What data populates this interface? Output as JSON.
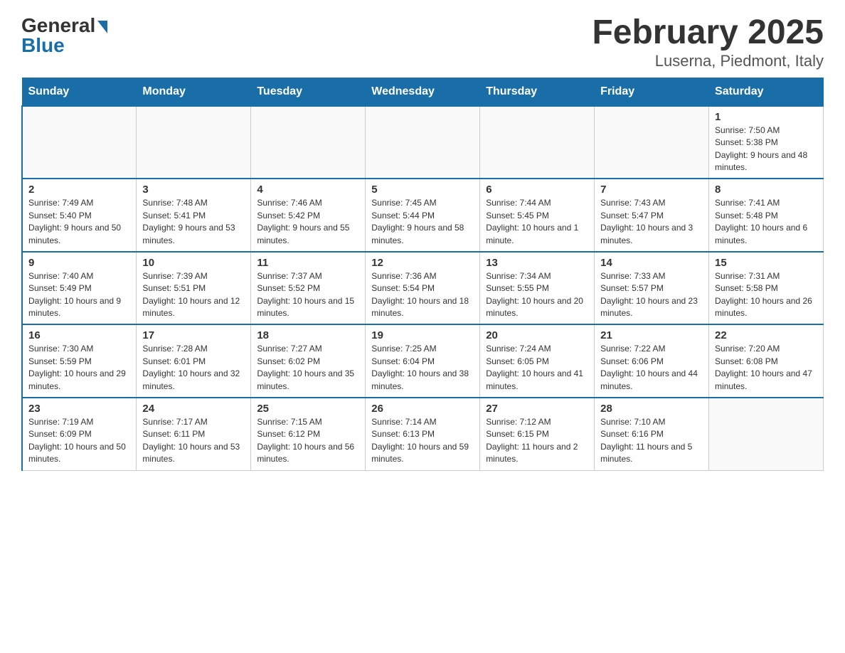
{
  "header": {
    "logo_general": "General",
    "logo_blue": "Blue",
    "title": "February 2025",
    "subtitle": "Luserna, Piedmont, Italy"
  },
  "days_of_week": [
    "Sunday",
    "Monday",
    "Tuesday",
    "Wednesday",
    "Thursday",
    "Friday",
    "Saturday"
  ],
  "weeks": [
    [
      {
        "day": "",
        "info": ""
      },
      {
        "day": "",
        "info": ""
      },
      {
        "day": "",
        "info": ""
      },
      {
        "day": "",
        "info": ""
      },
      {
        "day": "",
        "info": ""
      },
      {
        "day": "",
        "info": ""
      },
      {
        "day": "1",
        "info": "Sunrise: 7:50 AM\nSunset: 5:38 PM\nDaylight: 9 hours and 48 minutes."
      }
    ],
    [
      {
        "day": "2",
        "info": "Sunrise: 7:49 AM\nSunset: 5:40 PM\nDaylight: 9 hours and 50 minutes."
      },
      {
        "day": "3",
        "info": "Sunrise: 7:48 AM\nSunset: 5:41 PM\nDaylight: 9 hours and 53 minutes."
      },
      {
        "day": "4",
        "info": "Sunrise: 7:46 AM\nSunset: 5:42 PM\nDaylight: 9 hours and 55 minutes."
      },
      {
        "day": "5",
        "info": "Sunrise: 7:45 AM\nSunset: 5:44 PM\nDaylight: 9 hours and 58 minutes."
      },
      {
        "day": "6",
        "info": "Sunrise: 7:44 AM\nSunset: 5:45 PM\nDaylight: 10 hours and 1 minute."
      },
      {
        "day": "7",
        "info": "Sunrise: 7:43 AM\nSunset: 5:47 PM\nDaylight: 10 hours and 3 minutes."
      },
      {
        "day": "8",
        "info": "Sunrise: 7:41 AM\nSunset: 5:48 PM\nDaylight: 10 hours and 6 minutes."
      }
    ],
    [
      {
        "day": "9",
        "info": "Sunrise: 7:40 AM\nSunset: 5:49 PM\nDaylight: 10 hours and 9 minutes."
      },
      {
        "day": "10",
        "info": "Sunrise: 7:39 AM\nSunset: 5:51 PM\nDaylight: 10 hours and 12 minutes."
      },
      {
        "day": "11",
        "info": "Sunrise: 7:37 AM\nSunset: 5:52 PM\nDaylight: 10 hours and 15 minutes."
      },
      {
        "day": "12",
        "info": "Sunrise: 7:36 AM\nSunset: 5:54 PM\nDaylight: 10 hours and 18 minutes."
      },
      {
        "day": "13",
        "info": "Sunrise: 7:34 AM\nSunset: 5:55 PM\nDaylight: 10 hours and 20 minutes."
      },
      {
        "day": "14",
        "info": "Sunrise: 7:33 AM\nSunset: 5:57 PM\nDaylight: 10 hours and 23 minutes."
      },
      {
        "day": "15",
        "info": "Sunrise: 7:31 AM\nSunset: 5:58 PM\nDaylight: 10 hours and 26 minutes."
      }
    ],
    [
      {
        "day": "16",
        "info": "Sunrise: 7:30 AM\nSunset: 5:59 PM\nDaylight: 10 hours and 29 minutes."
      },
      {
        "day": "17",
        "info": "Sunrise: 7:28 AM\nSunset: 6:01 PM\nDaylight: 10 hours and 32 minutes."
      },
      {
        "day": "18",
        "info": "Sunrise: 7:27 AM\nSunset: 6:02 PM\nDaylight: 10 hours and 35 minutes."
      },
      {
        "day": "19",
        "info": "Sunrise: 7:25 AM\nSunset: 6:04 PM\nDaylight: 10 hours and 38 minutes."
      },
      {
        "day": "20",
        "info": "Sunrise: 7:24 AM\nSunset: 6:05 PM\nDaylight: 10 hours and 41 minutes."
      },
      {
        "day": "21",
        "info": "Sunrise: 7:22 AM\nSunset: 6:06 PM\nDaylight: 10 hours and 44 minutes."
      },
      {
        "day": "22",
        "info": "Sunrise: 7:20 AM\nSunset: 6:08 PM\nDaylight: 10 hours and 47 minutes."
      }
    ],
    [
      {
        "day": "23",
        "info": "Sunrise: 7:19 AM\nSunset: 6:09 PM\nDaylight: 10 hours and 50 minutes."
      },
      {
        "day": "24",
        "info": "Sunrise: 7:17 AM\nSunset: 6:11 PM\nDaylight: 10 hours and 53 minutes."
      },
      {
        "day": "25",
        "info": "Sunrise: 7:15 AM\nSunset: 6:12 PM\nDaylight: 10 hours and 56 minutes."
      },
      {
        "day": "26",
        "info": "Sunrise: 7:14 AM\nSunset: 6:13 PM\nDaylight: 10 hours and 59 minutes."
      },
      {
        "day": "27",
        "info": "Sunrise: 7:12 AM\nSunset: 6:15 PM\nDaylight: 11 hours and 2 minutes."
      },
      {
        "day": "28",
        "info": "Sunrise: 7:10 AM\nSunset: 6:16 PM\nDaylight: 11 hours and 5 minutes."
      },
      {
        "day": "",
        "info": ""
      }
    ]
  ]
}
